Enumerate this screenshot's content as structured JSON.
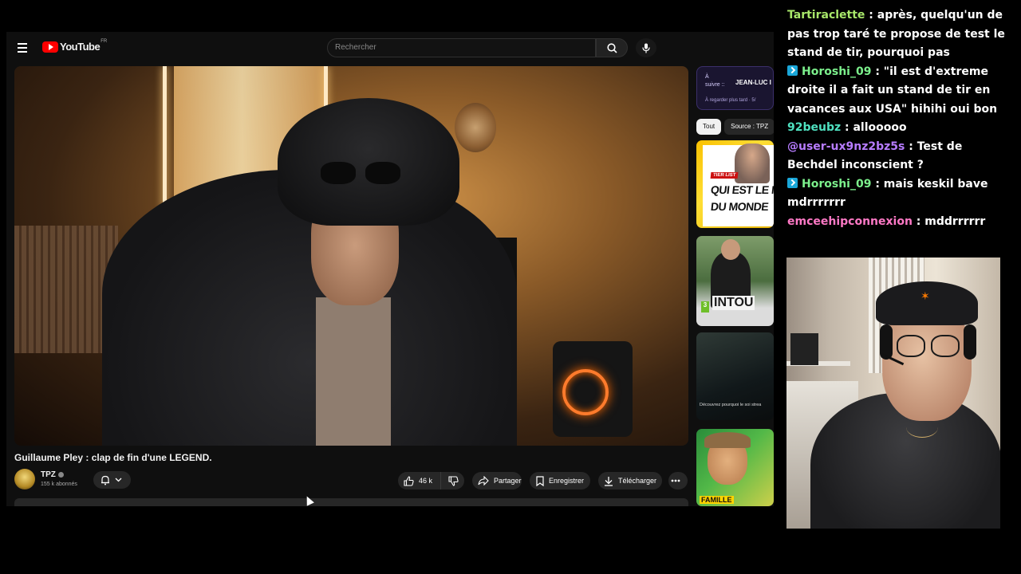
{
  "youtube": {
    "logo_text": "YouTube",
    "logo_region": "FR",
    "search": {
      "placeholder": "Rechercher"
    },
    "up_next": {
      "label_line1": "À",
      "label_line2": "suivre ::",
      "channel": "JEAN-LUC I",
      "later": "À regarder plus tard · 5/"
    },
    "chips": [
      {
        "label": "Tout",
        "active": true
      },
      {
        "label": "Source : TPZ",
        "active": false
      }
    ],
    "recommended": [
      {
        "tag": "TIER LIST",
        "line1": "QUI EST LE ME",
        "line2": "DU MONDE"
      },
      {
        "text": "INTOU",
        "rating": "3"
      },
      {
        "text": "Découvrez pourquoi le soi strea"
      },
      {
        "text": "FAMILLE"
      }
    ],
    "video": {
      "title": "Guillaume Pley : clap de fin d'une LEGEND.",
      "channel_name": "TPZ",
      "subscribers": "155 k abonnés"
    },
    "actions": {
      "likes": "46 k",
      "share": "Partager",
      "save": "Enregistrer",
      "download": "Télécharger"
    }
  },
  "chat": [
    {
      "user": "Tartiraclette",
      "color": "#a8e86a",
      "badge": false,
      "text": " : après, quelqu'un de pas trop taré te propose de test le stand de tir, pourquoi pas"
    },
    {
      "user": "Horoshi_09",
      "color": "#7cf08c",
      "badge": true,
      "text": " : \"il est d'extreme droite il a fait un stand de tir en vacances aux USA\" hihihi oui bon"
    },
    {
      "user": "92beubz",
      "color": "#4fe0c0",
      "badge": false,
      "text": " : allooooo"
    },
    {
      "user": "@user-ux9nz2bz5s",
      "color": "#b77cff",
      "badge": false,
      "text": " : Test de Bechdel inconscient ?"
    },
    {
      "user": "Horoshi_09",
      "color": "#7cf08c",
      "badge": true,
      "text": " : mais keskil bave mdrrrrrrr"
    },
    {
      "user": "emceehipconnexion",
      "color": "#ff79c6",
      "badge": false,
      "text": " : mddrrrrrr"
    }
  ]
}
